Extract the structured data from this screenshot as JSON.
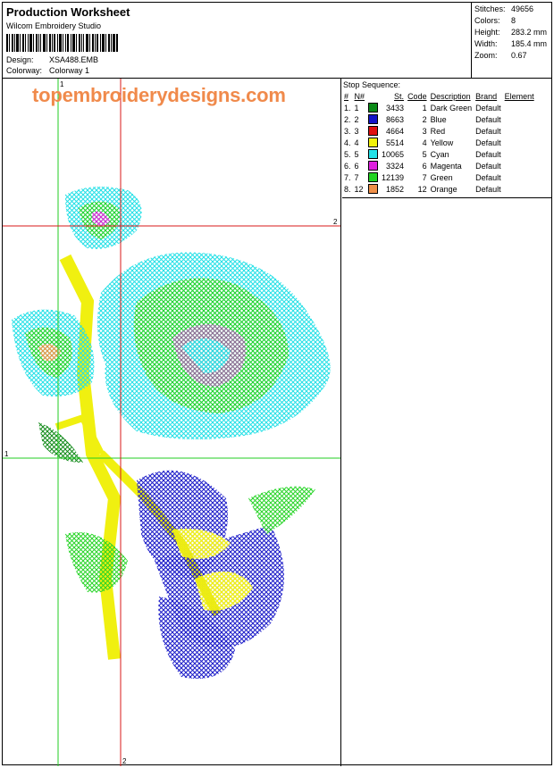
{
  "header": {
    "title": "Production Worksheet",
    "app_name": "Wilcom Embroidery Studio",
    "design_label": "Design:",
    "design_value": "XSA488.EMB",
    "colorway_label": "Colorway:",
    "colorway_value": "Colorway 1"
  },
  "stats": [
    {
      "label": "Stitches:",
      "value": "49656"
    },
    {
      "label": "Colors:",
      "value": "8"
    },
    {
      "label": "Height:",
      "value": "283.2 mm"
    },
    {
      "label": "Width:",
      "value": "185.4 mm"
    },
    {
      "label": "Zoom:",
      "value": "0.67"
    }
  ],
  "watermark": "topembroiderydesigns.com",
  "guides": {
    "label_1": "1",
    "label_2": "2"
  },
  "stop_sequence": {
    "caption": "Stop Sequence:",
    "columns": [
      "#",
      "N#",
      "St.",
      "Code",
      "Description",
      "Brand",
      "Element"
    ],
    "rows": [
      {
        "index": "1.",
        "n": "1",
        "color": "#0a8a16",
        "stitches": "3433",
        "code": "1",
        "description": "Dark Green",
        "brand": "Default"
      },
      {
        "index": "2.",
        "n": "2",
        "color": "#1414c8",
        "stitches": "8663",
        "code": "2",
        "description": "Blue",
        "brand": "Default"
      },
      {
        "index": "3.",
        "n": "3",
        "color": "#e01010",
        "stitches": "4664",
        "code": "3",
        "description": "Red",
        "brand": "Default"
      },
      {
        "index": "4.",
        "n": "4",
        "color": "#f2f20a",
        "stitches": "5514",
        "code": "4",
        "description": "Yellow",
        "brand": "Default"
      },
      {
        "index": "5.",
        "n": "5",
        "color": "#24e2e8",
        "stitches": "10065",
        "code": "5",
        "description": "Cyan",
        "brand": "Default"
      },
      {
        "index": "6.",
        "n": "6",
        "color": "#e020e0",
        "stitches": "3324",
        "code": "6",
        "description": "Magenta",
        "brand": "Default"
      },
      {
        "index": "7.",
        "n": "7",
        "color": "#22d422",
        "stitches": "12139",
        "code": "7",
        "description": "Green",
        "brand": "Default"
      },
      {
        "index": "8.",
        "n": "12",
        "color": "#f09048",
        "stitches": "1852",
        "code": "12",
        "description": "Orange",
        "brand": "Default"
      }
    ]
  }
}
